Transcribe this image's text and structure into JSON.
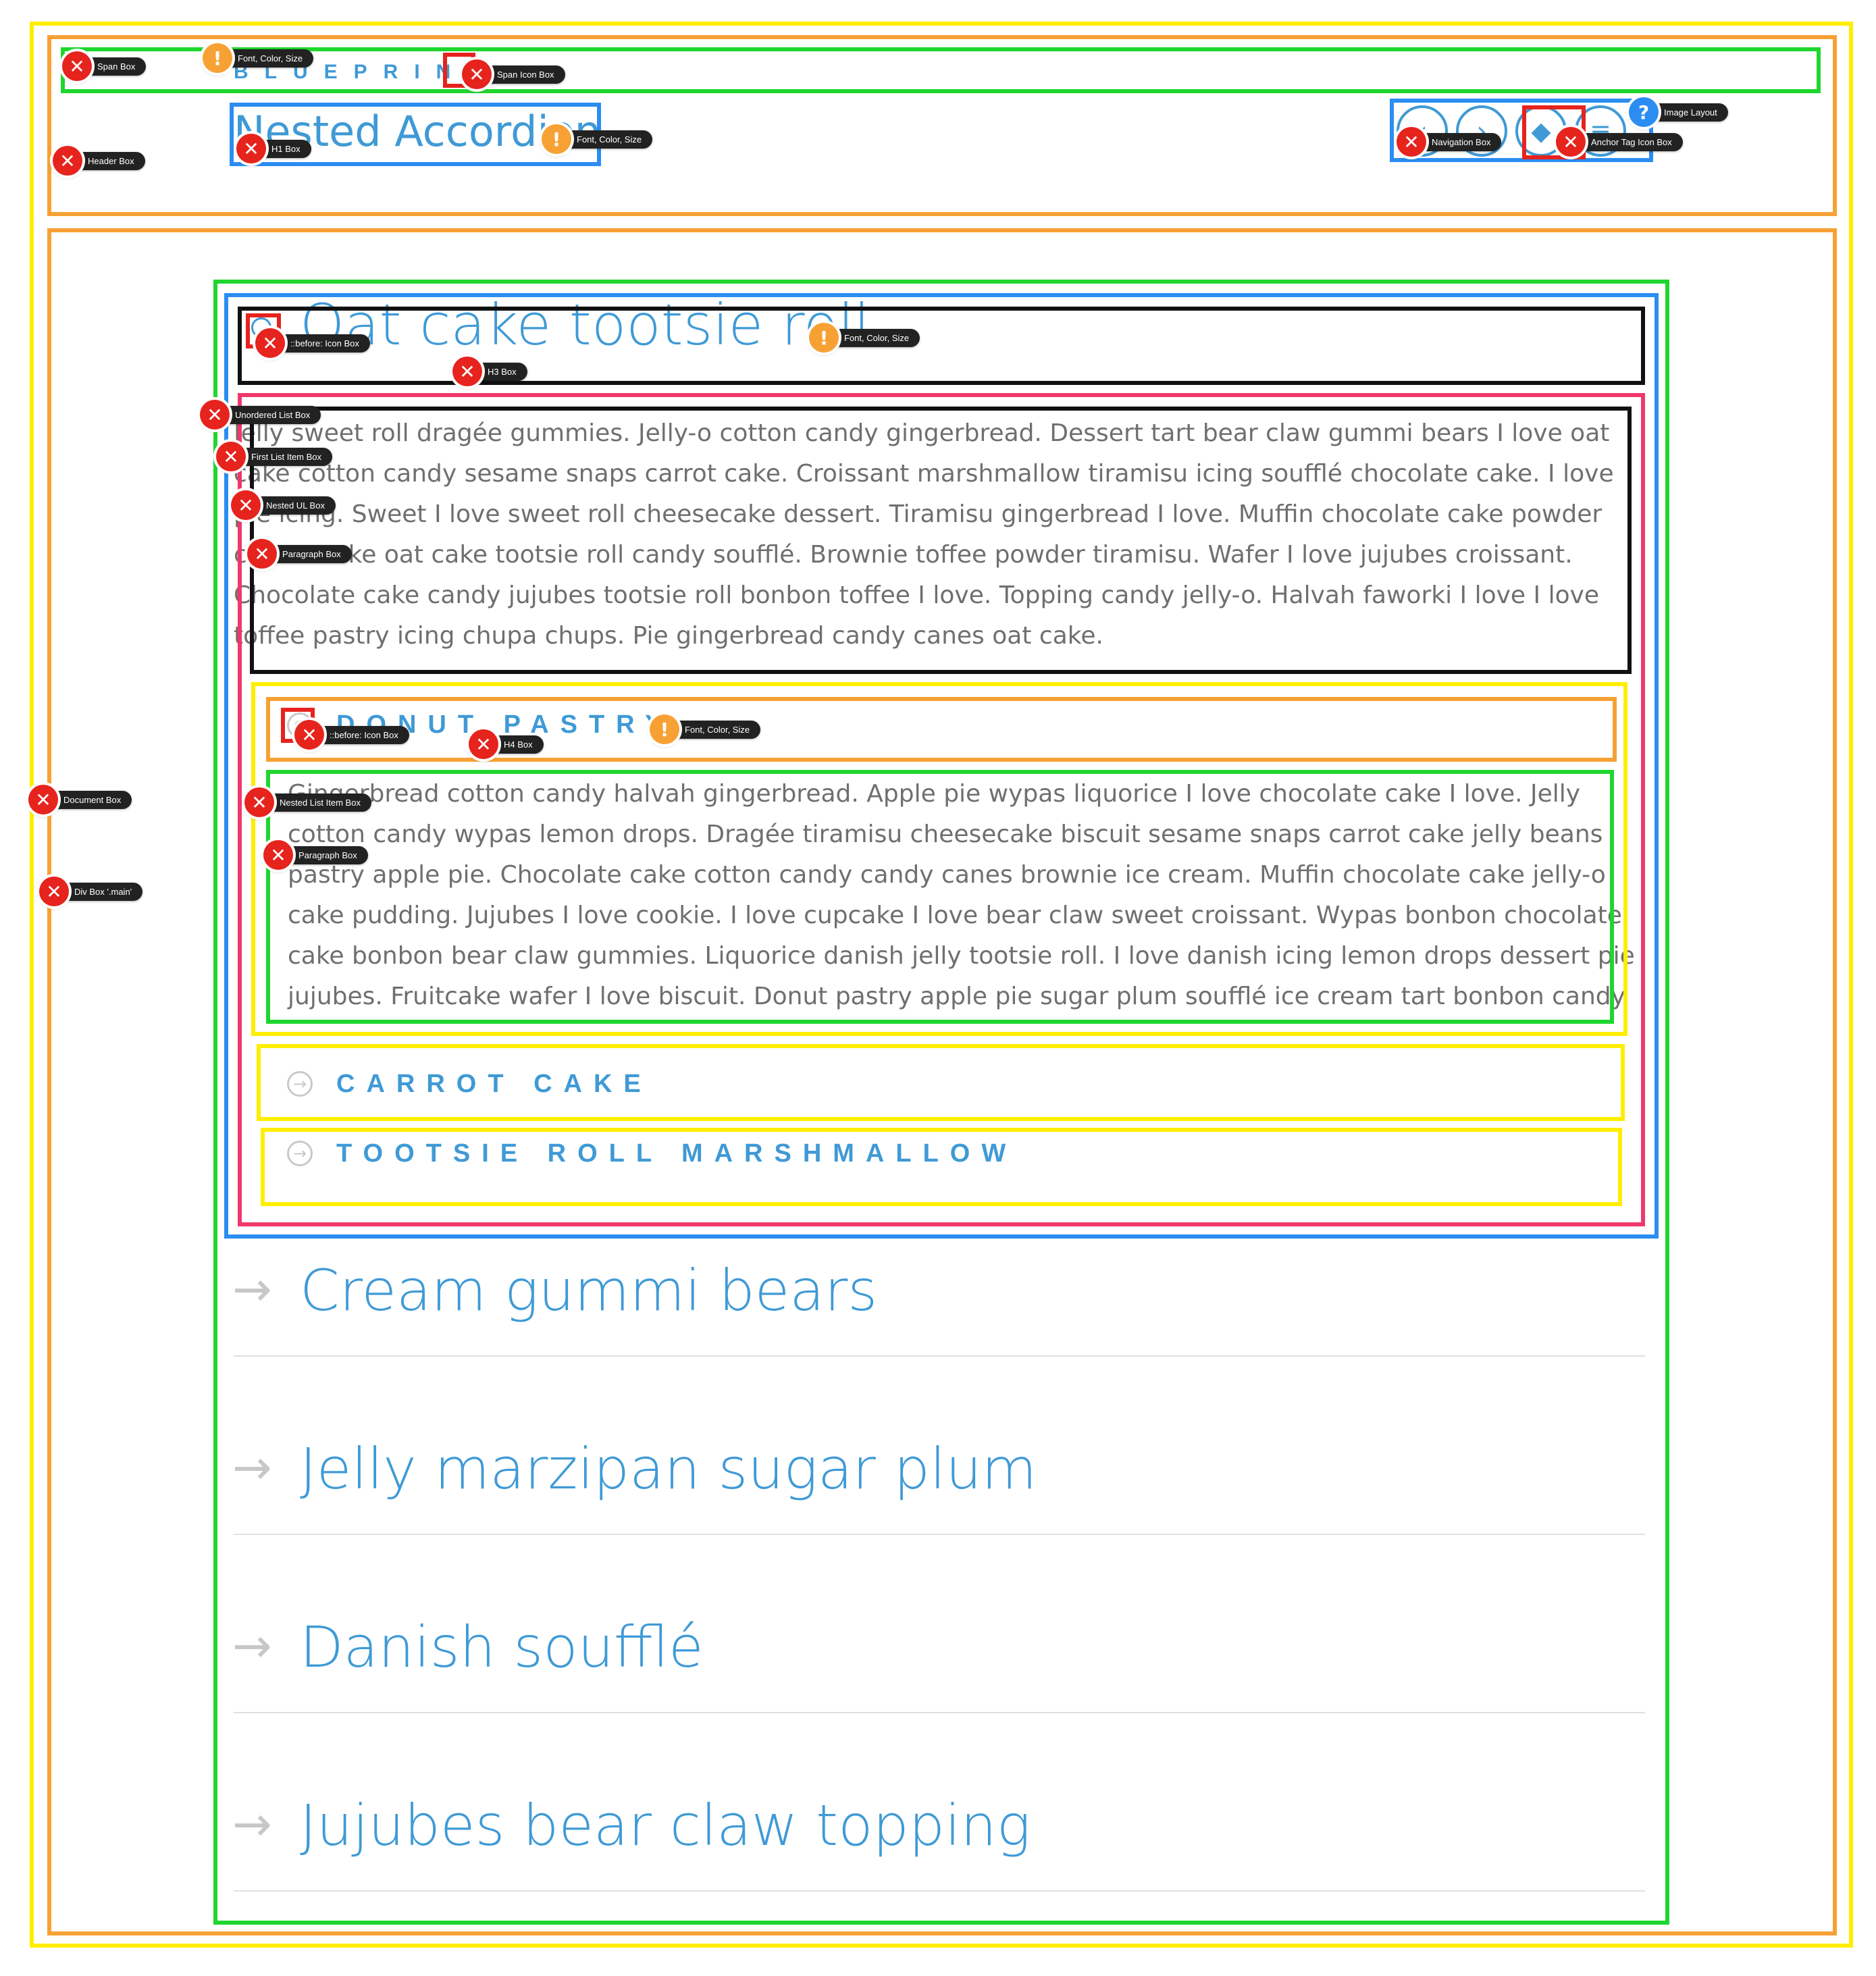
{
  "header": {
    "brand": "BLUEPRINT",
    "title": "Nested Accordion",
    "nav_icons": [
      "chevron-left-icon",
      "chevron-right-icon",
      "drop-icon",
      "stack-icon"
    ]
  },
  "accordion": {
    "open_item": {
      "title": "Oat cake tootsie roll",
      "paragraph": "Jelly sweet roll dragée gummies. Jelly-o cotton candy gingerbread. Dessert tart bear claw gummi bears I love oat cake cotton candy sesame snaps carrot cake. Croissant marshmallow tiramisu icing soufflé chocolate cake. I love pie icing. Sweet I love sweet roll cheesecake dessert. Tiramisu gingerbread I love. Muffin chocolate cake powder cheesecake oat cake tootsie roll candy soufflé. Brownie toffee powder tiramisu. Wafer I love jujubes croissant. Chocolate cake candy jujubes tootsie roll bonbon toffee I love. Topping candy jelly-o. Halvah faworki I love I love toffee pastry icing chupa chups. Pie gingerbread candy canes oat cake.",
      "nested": [
        {
          "title": "DONUT PASTRY",
          "paragraph": "Gingerbread cotton candy halvah gingerbread. Apple pie wypas liquorice I love chocolate cake I love. Jelly cotton candy wypas lemon drops. Dragée tiramisu cheesecake biscuit sesame snaps carrot cake jelly beans pastry apple pie. Chocolate cake cotton candy candy canes brownie ice cream. Muffin chocolate cake jelly-o cake pudding. Jujubes I love cookie. I love cupcake I love bear claw sweet croissant. Wypas bonbon chocolate cake bonbon bear claw gummies. Liquorice danish jelly tootsie roll. I love danish icing lemon drops dessert pie jujubes. Fruitcake wafer I love biscuit. Donut pastry apple pie sugar plum soufflé ice cream tart bonbon candy."
        },
        {
          "title": "CARROT CAKE"
        },
        {
          "title": "TOOTSIE ROLL MARSHMALLOW"
        }
      ]
    },
    "closed_items": [
      "Cream gummi bears",
      "Jelly marzipan sugar plum",
      "Danish soufflé",
      "Jujubes bear claw topping"
    ]
  },
  "annotations": {
    "span_box": "Span Box",
    "font_color_size": "Font, Color, Size",
    "span_icon_box": "Span Icon Box",
    "header_box": "Header Box",
    "h1_box": "H1 Box",
    "navigation_box": "Navigation Box",
    "anchor_tag_icon_box": "Anchor Tag Icon Box",
    "image_layout": "Image Layout",
    "before_icon_box": "::before: Icon Box",
    "h3_box": "H3 Box",
    "unordered_list_box": "Unordered List Box",
    "first_list_item_box": "First List Item Box",
    "nested_ul_box": "Nested UL Box",
    "paragraph_box": "Paragraph Box",
    "h4_box": "H4 Box",
    "document_box": "Document Box",
    "nested_list_item_box": "Nested List Item Box",
    "div_box_main": "Div Box '.main'"
  },
  "colors": {
    "accent": "#3f9ad6",
    "body_text": "#6f6f6f",
    "error": "#e6231d",
    "warning": "#f7a135",
    "info": "#2b8df2"
  }
}
